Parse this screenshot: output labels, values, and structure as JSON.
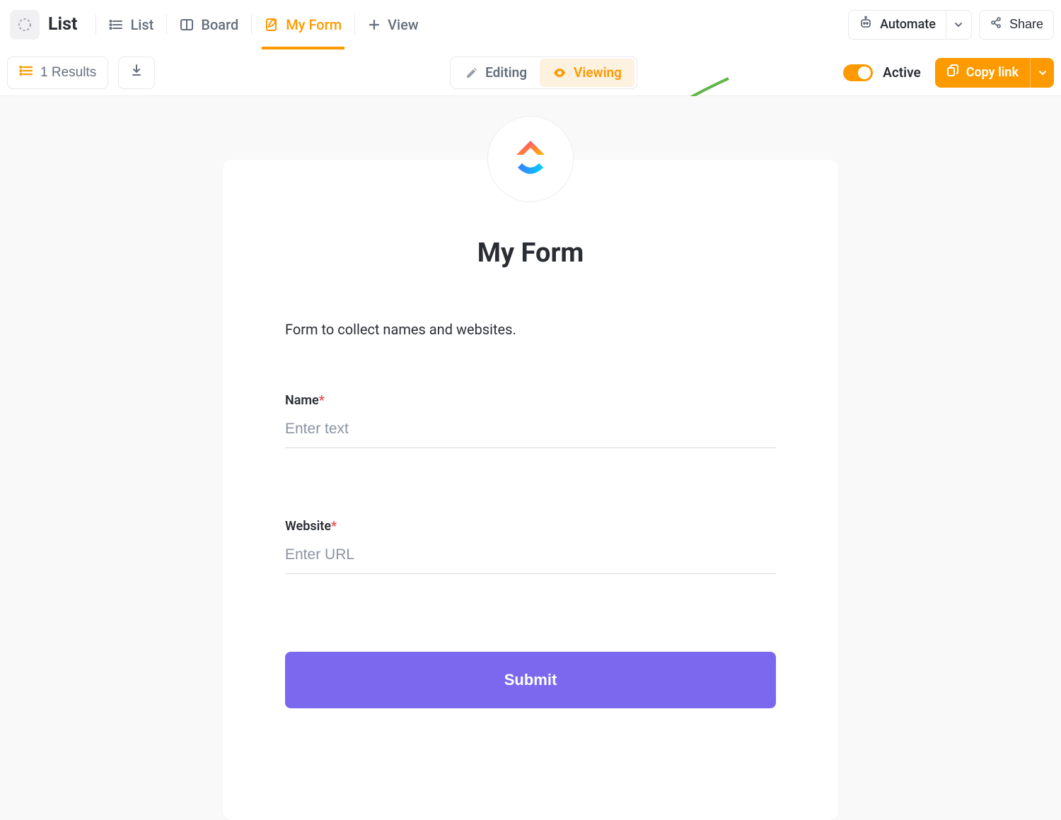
{
  "header": {
    "list_label": "List",
    "tabs": {
      "list": "List",
      "board": "Board",
      "myform": "My Form",
      "addview": "View"
    },
    "automate": "Automate",
    "share": "Share"
  },
  "toolbar": {
    "results": "1 Results",
    "editing": "Editing",
    "viewing": "Viewing",
    "active_label": "Active",
    "copy_link": "Copy link"
  },
  "form": {
    "title": "My Form",
    "description": "Form to collect names and websites.",
    "fields": {
      "name": {
        "label": "Name",
        "placeholder": "Enter text"
      },
      "website": {
        "label": "Website",
        "placeholder": "Enter URL"
      }
    },
    "submit": "Submit"
  },
  "colors": {
    "accent_orange": "#fd9a00",
    "accent_purple": "#7b68ee"
  }
}
